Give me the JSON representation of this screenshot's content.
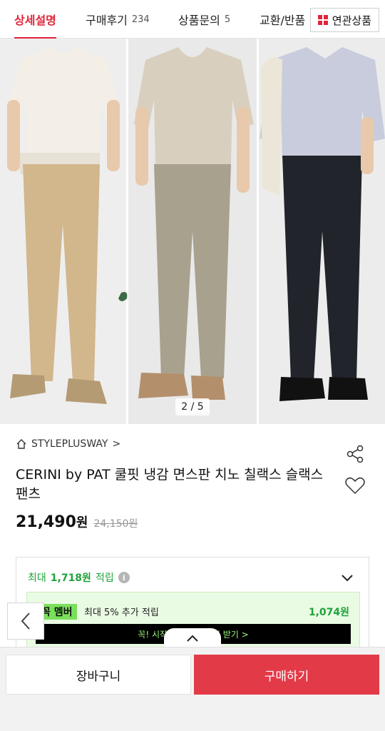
{
  "tabs": [
    {
      "label": "상세설명",
      "count": "",
      "active": true
    },
    {
      "label": "구매후기",
      "count": "234",
      "active": false
    },
    {
      "label": "상품문의",
      "count": "5",
      "active": false
    },
    {
      "label": "교환/반품",
      "count": "",
      "active": false
    }
  ],
  "related_button": {
    "label": "연관상품",
    "icon": "grid-icon"
  },
  "image": {
    "page_indicator": "2 / 5"
  },
  "product": {
    "brand": "STYLEPLUSWAY",
    "brand_chevron": ">",
    "title": "CERINI by PAT 쿨핏 냉감 면스판 치노 칠랙스 슬랙스 팬츠",
    "price": "21,490",
    "price_unit": "원",
    "original_price": "24,150원"
  },
  "points": {
    "prefix": "최대",
    "amount": "1,718원",
    "suffix": "적립",
    "info_glyph": "i",
    "member_badge": "꼭 멤버",
    "member_text": "최대 5% 추가 적립",
    "member_amount": "1,074원",
    "member_cta": "꼭! 시작하고 혜택 적립 받기 >"
  },
  "bottom": {
    "cart_label": "장바구니",
    "buy_label": "구매하기"
  },
  "colors": {
    "accent": "#e0253a",
    "buy_button": "#e33a48",
    "point_green": "#1fa33b",
    "member_badge": "#79e05a"
  }
}
